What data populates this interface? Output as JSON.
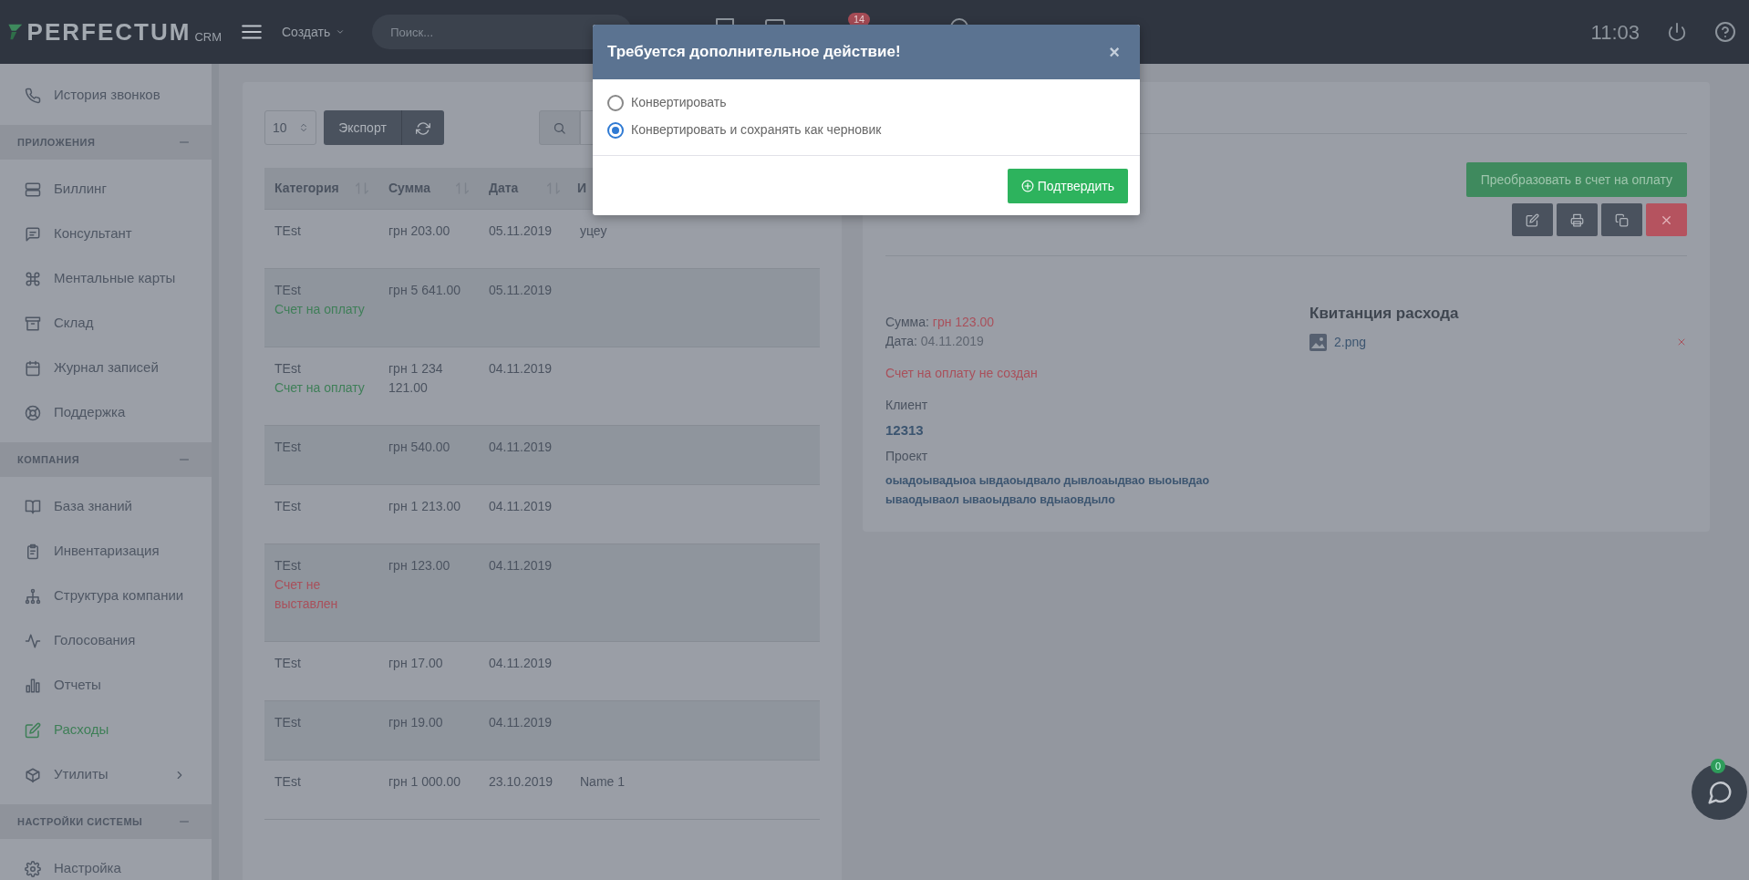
{
  "topbar": {
    "logo": "PERFECTUM",
    "logo_suffix": "CRM",
    "create_label": "Создать",
    "search": {
      "placeholder": "Поиск..."
    },
    "notification_count": "14",
    "time": "11:03"
  },
  "sidebar": [
    {
      "kind": "link",
      "label": "История звонков",
      "selected": false
    },
    {
      "kind": "section",
      "title": "ПРИЛОЖЕНИЯ",
      "expanded": true,
      "children": [
        {
          "kind": "link",
          "label": "Биллинг",
          "selected": false
        },
        {
          "kind": "link",
          "label": "Консультант",
          "selected": false
        },
        {
          "kind": "link",
          "label": "Ментальные карты",
          "selected": false
        },
        {
          "kind": "link",
          "label": "Склад",
          "selected": false
        },
        {
          "kind": "link",
          "label": "Журнал записей",
          "selected": false
        },
        {
          "kind": "link",
          "label": "Поддержка",
          "selected": false
        }
      ]
    },
    {
      "kind": "section",
      "title": "КОМПАНИЯ",
      "expanded": true,
      "children": [
        {
          "kind": "link",
          "label": "База знаний",
          "selected": false
        },
        {
          "kind": "link",
          "label": "Инвентаризация",
          "selected": false
        },
        {
          "kind": "link",
          "label": "Структура компании",
          "selected": false
        },
        {
          "kind": "link",
          "label": "Голосования",
          "selected": false
        },
        {
          "kind": "link",
          "label": "Отчеты",
          "selected": false
        },
        {
          "kind": "link",
          "label": "Расходы",
          "selected": true
        },
        {
          "kind": "group",
          "label": "Утилиты",
          "selected": false
        }
      ]
    },
    {
      "kind": "section",
      "title": "НАСТРОЙКИ СИСТЕМЫ",
      "expanded": true,
      "children": [
        {
          "kind": "link",
          "label": "Настройка",
          "selected": false
        }
      ]
    }
  ],
  "table": {
    "page_size": "10",
    "export_label": "Экспорт",
    "columns": [
      {
        "label": "Категория",
        "sortable": true
      },
      {
        "label": "Сумма",
        "sortable": true
      },
      {
        "label": "Дата",
        "sortable": true
      },
      {
        "label": "И"
      }
    ],
    "rows": [
      {
        "cells": [
          "TEst",
          "грн 203.00",
          "05.11.2019",
          "уцеу"
        ]
      },
      {
        "cells": [
          "TEst",
          "грн 5 641.00",
          "05.11.2019"
        ],
        "status": {
          "kind": "invoiced",
          "text": "Счет на оплату"
        }
      },
      {
        "cells": [
          "TEst",
          "грн 1 234 121.00",
          "04.11.2019"
        ],
        "status": {
          "kind": "invoiced",
          "text": "Счет на оплату"
        }
      },
      {
        "cells": [
          "TEst",
          "грн 540.00",
          "04.11.2019"
        ]
      },
      {
        "cells": [
          "TEst",
          "грн 1 213.00",
          "04.11.2019"
        ]
      },
      {
        "cells": [
          "TEst",
          "грн 123.00",
          "04.11.2019"
        ],
        "status": {
          "kind": "not_invoiced",
          "text": "Счет не выставлен"
        }
      },
      {
        "cells": [
          "TEst",
          "грн 17.00",
          "04.11.2019"
        ]
      },
      {
        "cells": [
          "TEst",
          "грн 19.00",
          "04.11.2019"
        ]
      },
      {
        "cells": [
          "TEst",
          "грн 1 000.00",
          "23.10.2019",
          "Name 1"
        ]
      }
    ]
  },
  "detail": {
    "convert_button": "Преобразовать в счет на оплату",
    "actions": [
      {
        "kind": "edit"
      },
      {
        "kind": "print"
      },
      {
        "kind": "copy"
      },
      {
        "kind": "delete"
      }
    ],
    "amount_label": "Сумма:",
    "amount": "грн 123.00",
    "date_label": "Дата:",
    "date": "04.11.2019",
    "invoice_status": "Счет на оплату не создан",
    "client_label": "Клиент",
    "client": "12313",
    "project_label": "Проект",
    "project": "оыадоывадыоа ывдаоыдвало дывлоаыдвао выоывдао ываодываол ываоыдвало вдыаовдыло",
    "receipt_title": "Квитанция расхода",
    "attachments": [
      {
        "name": "2.png"
      }
    ]
  },
  "modal": {
    "title": "Требуется дополнительное действие!",
    "close": "×",
    "options": [
      {
        "label": "Конвертировать",
        "selected": false
      },
      {
        "label": "Конвертировать и сохранять как черновик",
        "selected": true
      }
    ],
    "confirm_label": "Подтвердить"
  },
  "chat": {
    "badge": "0"
  }
}
